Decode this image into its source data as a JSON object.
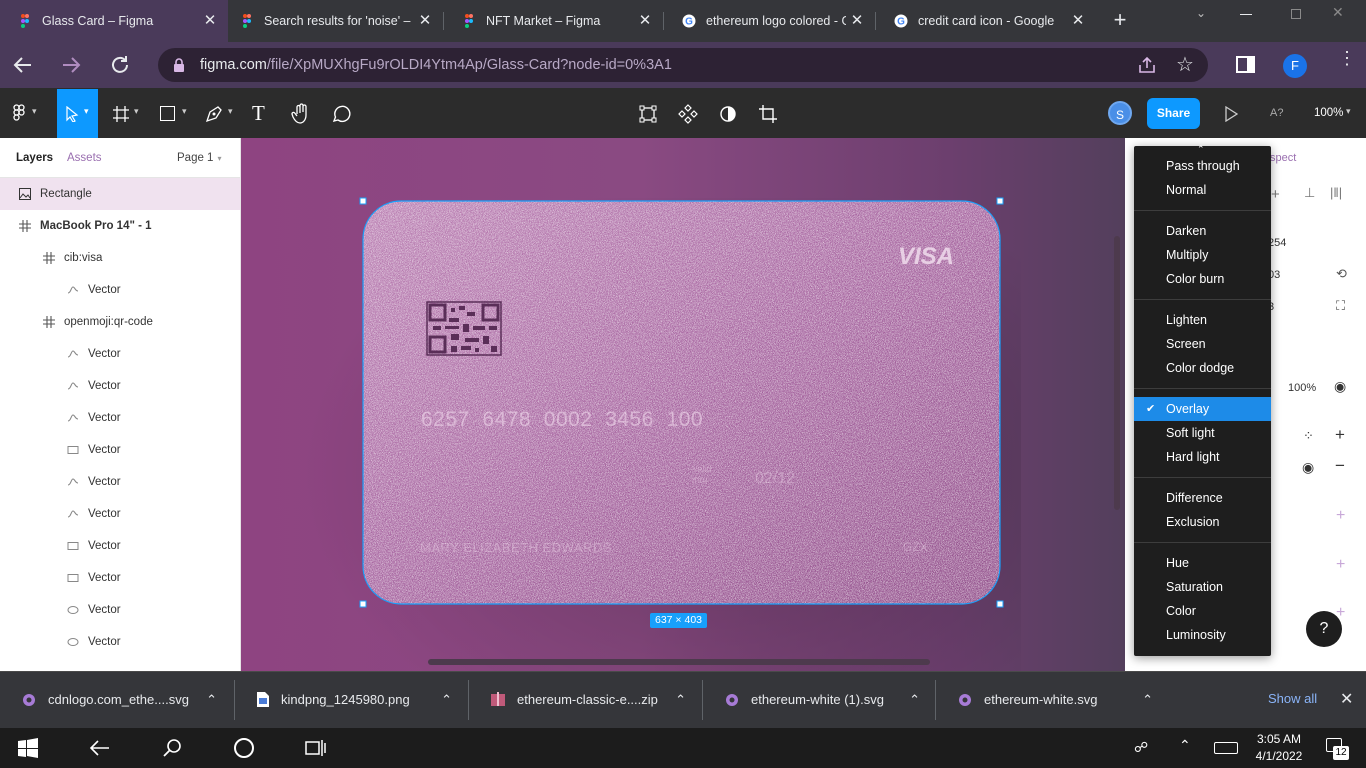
{
  "tabs": [
    {
      "title": "Glass Card – Figma",
      "icon": "figma-icon",
      "active": true
    },
    {
      "title": "Search results for 'noise' –",
      "icon": "figma-icon",
      "active": false
    },
    {
      "title": "NFT Market – Figma",
      "icon": "figma-icon",
      "active": false
    },
    {
      "title": "ethereum logo colored - G",
      "icon": "google-icon",
      "active": false
    },
    {
      "title": "credit card icon - Google S",
      "icon": "google-icon",
      "active": false
    }
  ],
  "address": {
    "host": "figma.com",
    "path": "/file/XpMUXhgFu9rOLDI4Ytm4Ap/Glass-Card?node-id=0%3A1"
  },
  "profile_initial": "F",
  "figma": {
    "user_initial": "S",
    "share_label": "Share",
    "font_indicator": "A?",
    "zoom": "100%"
  },
  "left_panel": {
    "tab_layers": "Layers",
    "tab_assets": "Assets",
    "page": "Page 1",
    "layers": [
      {
        "name": "Rectangle",
        "icon": "image-icon",
        "level": 0,
        "bold": false,
        "selected": true
      },
      {
        "name": "MacBook Pro 14\" - 1",
        "icon": "frame-icon",
        "level": 0,
        "bold": true,
        "selected": false
      },
      {
        "name": "cib:visa",
        "icon": "frame-icon",
        "level": 1,
        "bold": false,
        "selected": false
      },
      {
        "name": "Vector",
        "icon": "vector-icon",
        "level": 2,
        "bold": false,
        "selected": false
      },
      {
        "name": "openmoji:qr-code",
        "icon": "frame-icon",
        "level": 1,
        "bold": false,
        "selected": false
      },
      {
        "name": "Vector",
        "icon": "vector-icon",
        "level": 2,
        "bold": false,
        "selected": false
      },
      {
        "name": "Vector",
        "icon": "vector-icon",
        "level": 2,
        "bold": false,
        "selected": false
      },
      {
        "name": "Vector",
        "icon": "vector-icon",
        "level": 2,
        "bold": false,
        "selected": false
      },
      {
        "name": "Vector",
        "icon": "rectangle-icon",
        "level": 2,
        "bold": false,
        "selected": false
      },
      {
        "name": "Vector",
        "icon": "vector-icon",
        "level": 2,
        "bold": false,
        "selected": false
      },
      {
        "name": "Vector",
        "icon": "vector-icon",
        "level": 2,
        "bold": false,
        "selected": false
      },
      {
        "name": "Vector",
        "icon": "rectangle-icon",
        "level": 2,
        "bold": false,
        "selected": false
      },
      {
        "name": "Vector",
        "icon": "rectangle-icon",
        "level": 2,
        "bold": false,
        "selected": false
      },
      {
        "name": "Vector",
        "icon": "ellipse-icon",
        "level": 2,
        "bold": false,
        "selected": false
      },
      {
        "name": "Vector",
        "icon": "ellipse-icon",
        "level": 2,
        "bold": false,
        "selected": false
      }
    ]
  },
  "card": {
    "brand": "VISA",
    "number": "6257  6478  0002  3456  100",
    "valid_label": "Valid",
    "valid_label2": "thru",
    "expiry": "02/12",
    "holder": "MARY ELIZABETH EDWARDS",
    "code": "GZX",
    "size_label": "637 × 403"
  },
  "right_panel": {
    "tab_inspect_fragment": "spect",
    "values": [
      "254",
      "03",
      "3"
    ],
    "opacity": "100%"
  },
  "blend_menu": {
    "groups": [
      [
        "Pass through",
        "Normal"
      ],
      [
        "Darken",
        "Multiply",
        "Color burn"
      ],
      [
        "Lighten",
        "Screen",
        "Color dodge"
      ],
      [
        "Overlay",
        "Soft light",
        "Hard light"
      ],
      [
        "Difference",
        "Exclusion"
      ],
      [
        "Hue",
        "Saturation",
        "Color",
        "Luminosity"
      ]
    ],
    "selected": "Overlay"
  },
  "help_label": "?",
  "downloads": {
    "items": [
      {
        "name": "cdnlogo.com_ethe....svg",
        "icon": "chrome-file-icon"
      },
      {
        "name": "kindpng_1245980.png",
        "icon": "image-file-icon"
      },
      {
        "name": "ethereum-classic-e....zip",
        "icon": "zip-file-icon"
      },
      {
        "name": "ethereum-white (1).svg",
        "icon": "chrome-file-icon"
      },
      {
        "name": "ethereum-white.svg",
        "icon": "chrome-file-icon"
      }
    ],
    "show_all": "Show all"
  },
  "taskbar": {
    "time": "3:05 AM",
    "date": "4/1/2022",
    "notifications": "12"
  }
}
